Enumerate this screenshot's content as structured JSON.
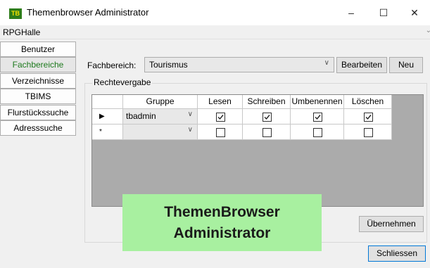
{
  "window": {
    "icon_text": "TB",
    "title": "Themenbrowser Administrator",
    "controls": {
      "minimize": "–",
      "maximize": "☐",
      "close": "✕"
    }
  },
  "menubar": {
    "label": "RPGHalle"
  },
  "nav": {
    "items": [
      {
        "label": "Benutzer",
        "active": false
      },
      {
        "label": "Fachbereiche",
        "active": true
      },
      {
        "label": "Verzeichnisse",
        "active": false
      },
      {
        "label": "TBIMS",
        "active": false
      },
      {
        "label": "Flurstückssuche",
        "active": false
      },
      {
        "label": "Adresssuche",
        "active": false
      }
    ]
  },
  "fachbereich": {
    "label": "Fachbereich:",
    "value": "Tourismus",
    "edit_button": "Bearbeiten",
    "new_button": "Neu"
  },
  "rechtevergabe": {
    "title": "Rechtevergabe",
    "columns": [
      "Gruppe",
      "Lesen",
      "Schreiben",
      "Umbenennen",
      "Löschen"
    ],
    "rows": [
      {
        "indicator": "▶",
        "gruppe": "tbadmin",
        "lesen": true,
        "schreiben": true,
        "umbenennen": true,
        "loeschen": true
      },
      {
        "indicator": "*",
        "gruppe": "",
        "lesen": false,
        "schreiben": false,
        "umbenennen": false,
        "loeschen": false
      }
    ],
    "apply_button": "Übernehmen"
  },
  "footer": {
    "close_button": "Schliessen"
  },
  "overlay": {
    "line1": "ThemenBrowser",
    "line2": "Administrator"
  }
}
